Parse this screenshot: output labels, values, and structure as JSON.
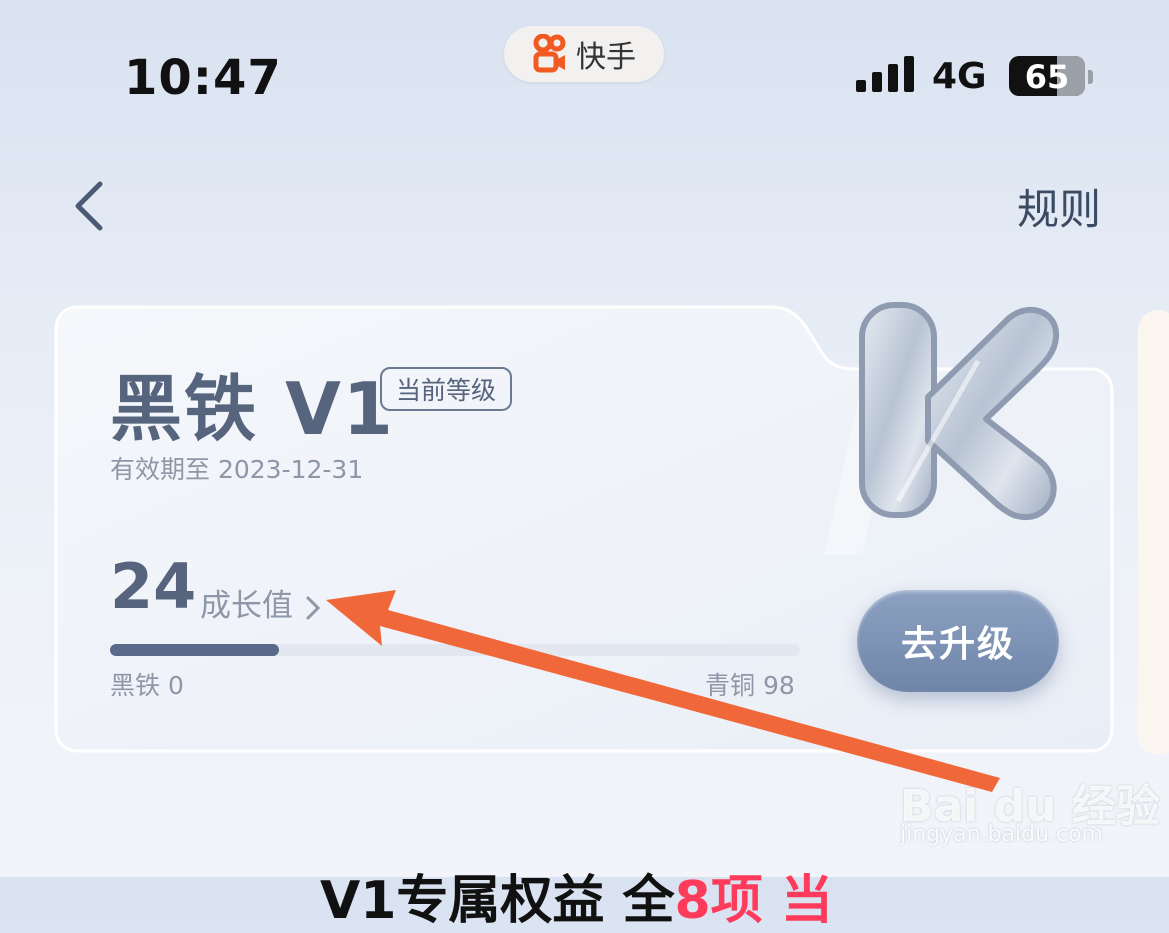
{
  "status_bar": {
    "time": "10:47",
    "app_name": "快手",
    "network": "4G",
    "battery": "65"
  },
  "nav": {
    "rules_label": "规则"
  },
  "level_card": {
    "level_name": "黑铁 V1",
    "current_tag": "当前等级",
    "expiry": "有效期至 2023-12-31",
    "growth_value": "24",
    "growth_label": "成长值",
    "progress_fraction": 0.245,
    "tier_start": "黑铁 0",
    "tier_end": "青铜 98",
    "upgrade_label": "去升级"
  },
  "bottom": {
    "heading_main": "V1专属权益 全",
    "heading_highlight": "8项 当"
  },
  "watermark": {
    "logo": "Bai du 经验",
    "url": "jingyan.baidu.com"
  },
  "colors": {
    "accent": "#ff3b5c",
    "annotation_arrow": "#f0673a",
    "brand": "#f25a22"
  }
}
